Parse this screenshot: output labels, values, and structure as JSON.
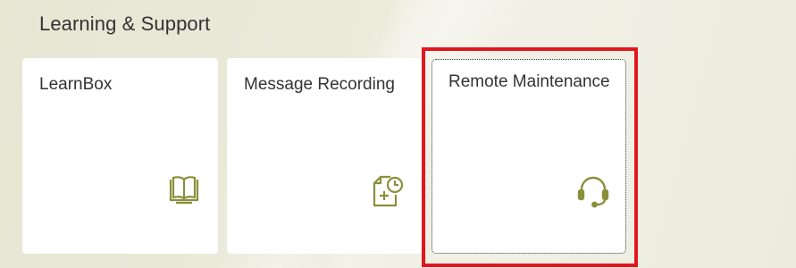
{
  "section": {
    "title": "Learning & Support"
  },
  "tiles": [
    {
      "label": "LearnBox",
      "icon": "book-icon"
    },
    {
      "label": "Message Recording",
      "icon": "document-clock-icon"
    },
    {
      "label": "Remote Maintenance",
      "icon": "headset-icon"
    }
  ],
  "colors": {
    "icon": "#8a8f3a",
    "highlight": "#e2161f",
    "text": "#333333",
    "tile_bg": "#ffffff"
  }
}
